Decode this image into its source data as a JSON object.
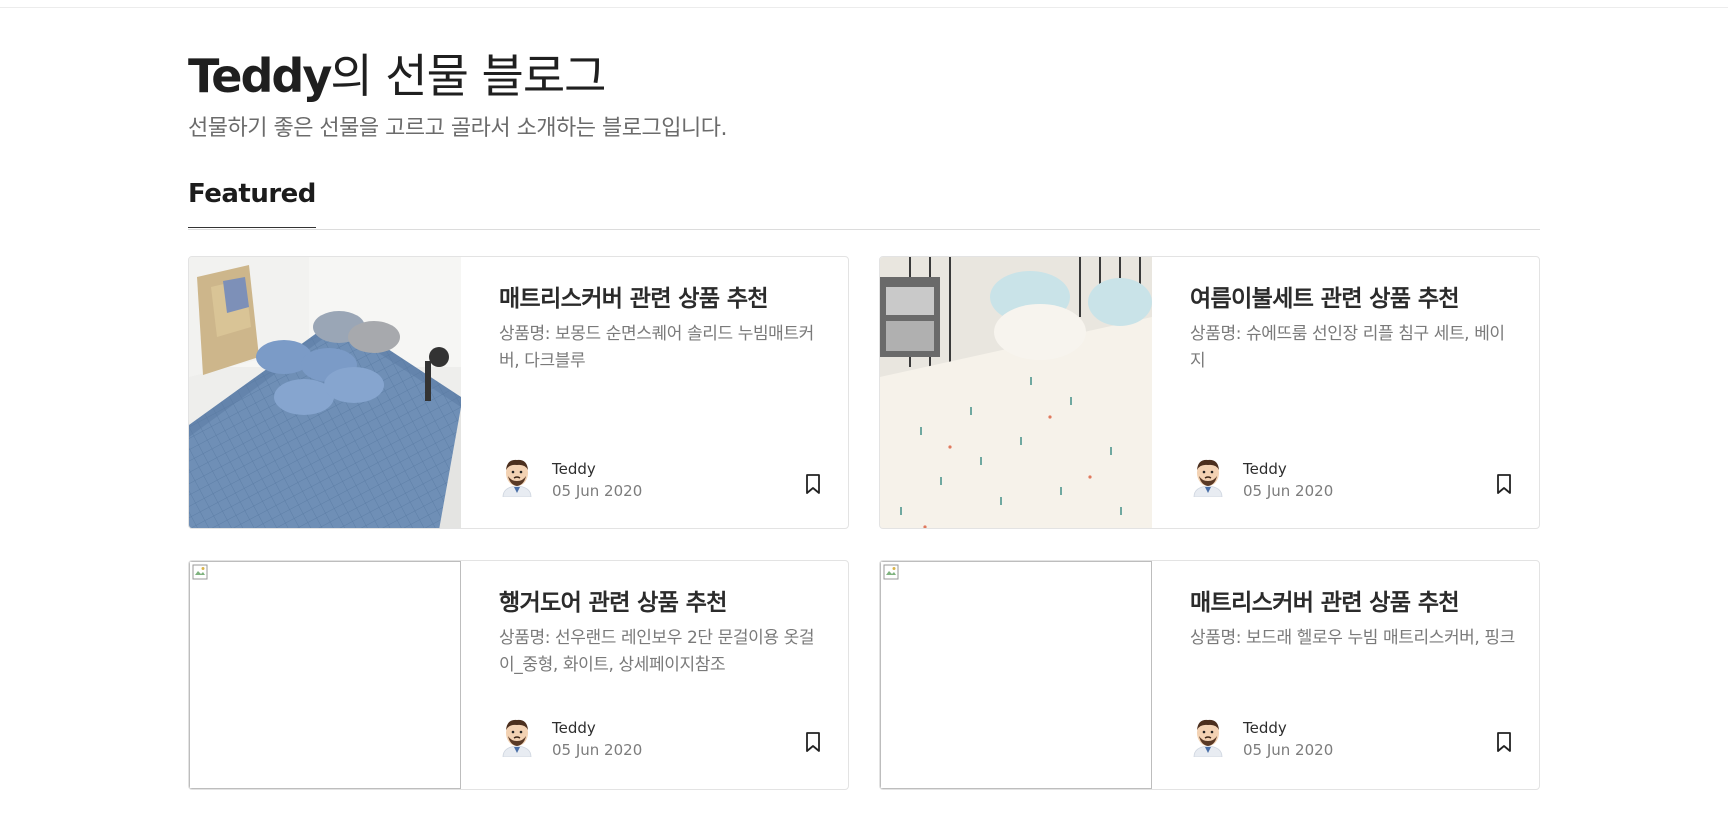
{
  "blog": {
    "brand": "Teddy",
    "title_suffix": "의 선물 블로그",
    "description": "선물하기 좋은 선물을 고르고 골라서 소개하는 블로그입니다."
  },
  "section": {
    "tab_label": "Featured"
  },
  "posts": [
    {
      "title": "매트리스커버 관련 상품 추천",
      "excerpt": "상품명: 보몽드 순면스퀘어 솔리드 누빔매트커버, 다크블루",
      "author": "Teddy",
      "date": "05 Jun 2020",
      "image": "blue-mattress-photo"
    },
    {
      "title": "여름이불세트 관련 상품 추천",
      "excerpt": "상품명: 슈에뜨룸 선인장 리플 침구 세트, 베이지",
      "author": "Teddy",
      "date": "05 Jun 2020",
      "image": "cactus-bedding-photo"
    },
    {
      "title": "행거도어 관련 상품 추천",
      "excerpt": "상품명: 선우랜드 레인보우 2단 문걸이용 옷걸이_중형, 화이트, 상세페이지참조",
      "author": "Teddy",
      "date": "05 Jun 2020",
      "image": "broken-image"
    },
    {
      "title": "매트리스커버 관련 상품 추천",
      "excerpt": "상품명: 보드래 헬로우 누빔 매트리스커버, 핑크",
      "author": "Teddy",
      "date": "05 Jun 2020",
      "image": "broken-image"
    }
  ],
  "icons": {
    "bookmark": "bookmark-icon",
    "avatar": "teddy-avatar-icon"
  }
}
